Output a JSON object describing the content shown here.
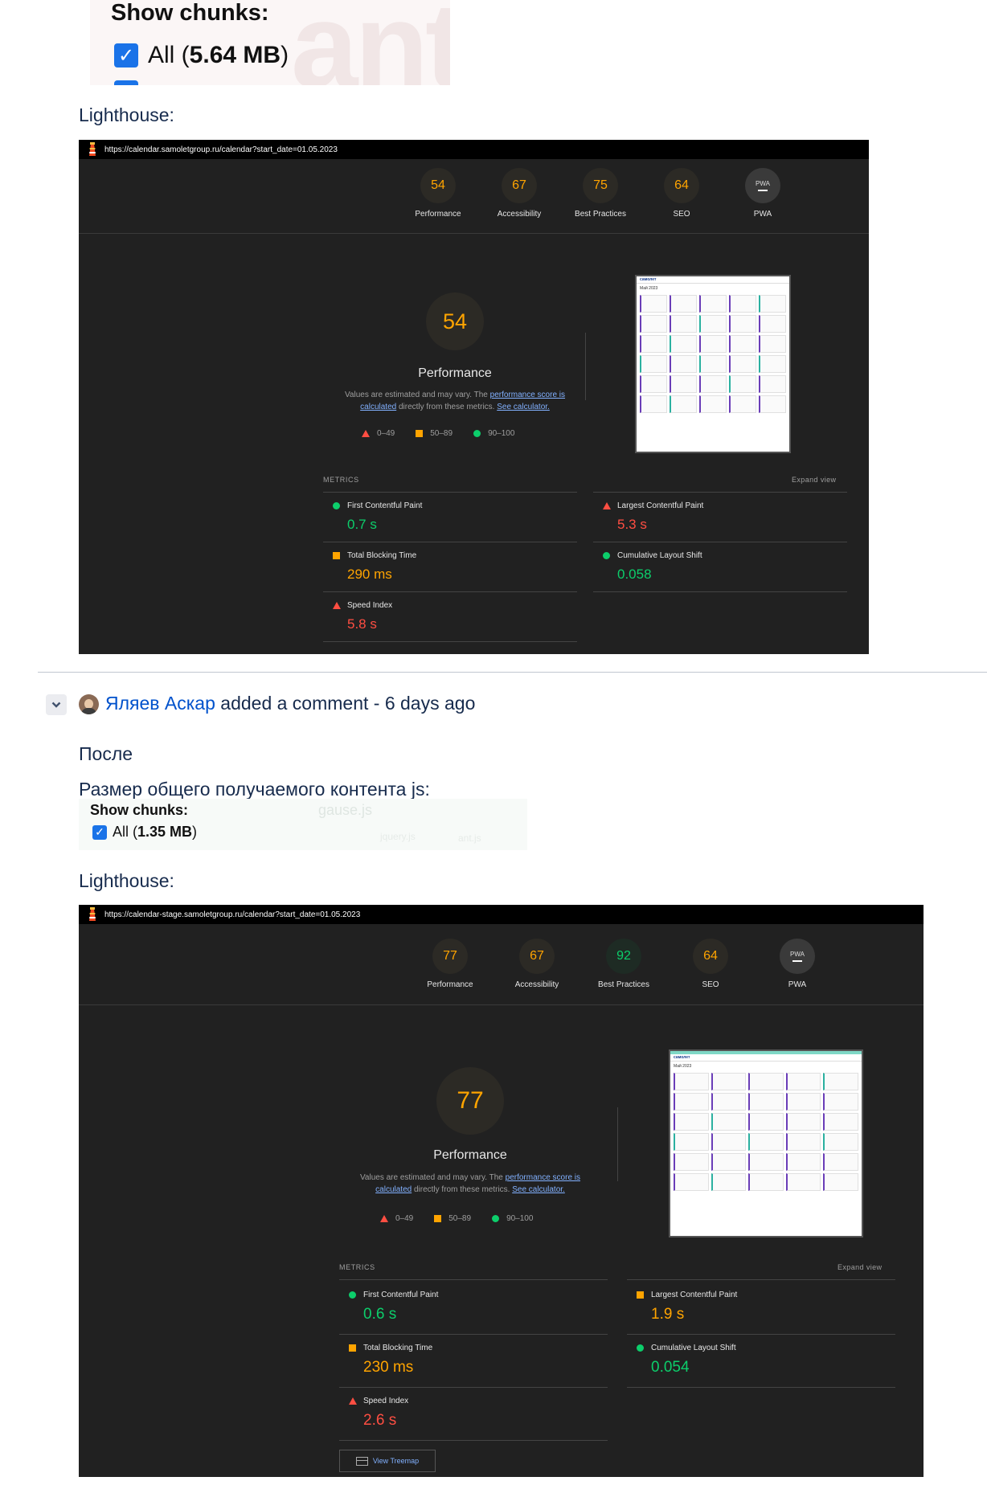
{
  "chunks_before": {
    "title": "Show chunks:",
    "all_prefix": "All (",
    "all_size": "5.64 MB",
    "all_suffix": ")",
    "ghost": "ant"
  },
  "label_lighthouse_1": "Lighthouse:",
  "report_before": {
    "url": "https://calendar.samoletgroup.ru/calendar?start_date=01.05.2023",
    "categories": [
      {
        "label": "Performance",
        "score": "54",
        "color": "#ffa400"
      },
      {
        "label": "Accessibility",
        "score": "67",
        "color": "#ffa400"
      },
      {
        "label": "Best Practices",
        "score": "75",
        "color": "#ffa400"
      },
      {
        "label": "SEO",
        "score": "64",
        "color": "#ffa400"
      },
      {
        "label": "PWA",
        "score": "PWA"
      }
    ],
    "main_score": "54",
    "main_label": "Performance",
    "note_pre": "Values are estimated and may vary. The ",
    "note_link1": "performance score is calculated",
    "note_mid": " directly from these metrics. ",
    "note_link2": "See calculator.",
    "legend": [
      "0–49",
      "50–89",
      "90–100"
    ],
    "metrics_header": "METRICS",
    "expand_label": "Expand view",
    "metrics": [
      {
        "name": "First Contentful Paint",
        "value": "0.7 s",
        "status": "pass"
      },
      {
        "name": "Largest Contentful Paint",
        "value": "5.3 s",
        "status": "fail"
      },
      {
        "name": "Total Blocking Time",
        "value": "290 ms",
        "status": "average"
      },
      {
        "name": "Cumulative Layout Shift",
        "value": "0.058",
        "status": "pass"
      },
      {
        "name": "Speed Index",
        "value": "5.8 s",
        "status": "fail"
      }
    ],
    "thumb_logo": "самолет",
    "thumb_title": "Май 2023"
  },
  "comment": {
    "author": "Яляев Аскар",
    "action": " added a comment - 6 days ago"
  },
  "label_after": "После",
  "label_js_size": "Размер общего получаемого контента js:",
  "chunks_after": {
    "title": "Show chunks:",
    "all_prefix": "All (",
    "all_size": "1.35 MB",
    "all_suffix": ")",
    "ghost1": "gause.js",
    "ghost2": "jquery.js",
    "ghost3": "ant.js"
  },
  "label_lighthouse_2": "Lighthouse:",
  "report_after": {
    "url": "https://calendar-stage.samoletgroup.ru/calendar?start_date=01.05.2023",
    "categories": [
      {
        "label": "Performance",
        "score": "77",
        "color": "#ffa400"
      },
      {
        "label": "Accessibility",
        "score": "67",
        "color": "#ffa400"
      },
      {
        "label": "Best Practices",
        "score": "92",
        "color": "#0cce6b"
      },
      {
        "label": "SEO",
        "score": "64",
        "color": "#ffa400"
      },
      {
        "label": "PWA",
        "score": "PWA"
      }
    ],
    "main_score": "77",
    "main_label": "Performance",
    "note_pre": "Values are estimated and may vary. The ",
    "note_link1": "performance score is calculated",
    "note_mid": " directly from these metrics. ",
    "note_link2": "See calculator.",
    "legend": [
      "0–49",
      "50–89",
      "90–100"
    ],
    "metrics_header": "METRICS",
    "expand_label": "Expand view",
    "metrics": [
      {
        "name": "First Contentful Paint",
        "value": "0.6 s",
        "status": "pass"
      },
      {
        "name": "Largest Contentful Paint",
        "value": "1.9 s",
        "status": "average"
      },
      {
        "name": "Total Blocking Time",
        "value": "230 ms",
        "status": "average"
      },
      {
        "name": "Cumulative Layout Shift",
        "value": "0.054",
        "status": "pass"
      },
      {
        "name": "Speed Index",
        "value": "2.6 s",
        "status": "fail"
      }
    ],
    "treemap_label": "View Treemap",
    "thumb_logo": "самолет",
    "thumb_title": "Май 2023"
  }
}
